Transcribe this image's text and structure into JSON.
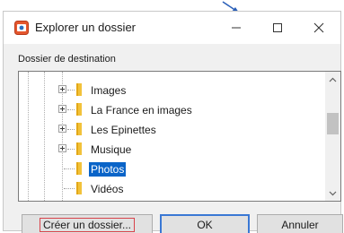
{
  "window": {
    "title": "Explorer un dossier",
    "controls": {
      "minimize": "minimize-icon",
      "maximize": "maximize-icon",
      "close": "close-icon"
    }
  },
  "section_label": "Dossier de destination",
  "tree": {
    "items": [
      {
        "label": "Images",
        "expandable": true,
        "selected": false
      },
      {
        "label": "La France en images",
        "expandable": true,
        "selected": false
      },
      {
        "label": "Les Epinettes",
        "expandable": true,
        "selected": false
      },
      {
        "label": "Musique",
        "expandable": true,
        "selected": false
      },
      {
        "label": "Photos",
        "expandable": false,
        "selected": true
      },
      {
        "label": "Vidéos",
        "expandable": false,
        "selected": false
      }
    ]
  },
  "buttons": {
    "new_folder": "Créer un dossier...",
    "ok": "OK",
    "cancel": "Annuler"
  },
  "colors": {
    "accent": "#0a64c8",
    "focus_border": "#3a78d4",
    "folder": "#f2c23a",
    "new_folder_highlight": "#d8424a"
  }
}
